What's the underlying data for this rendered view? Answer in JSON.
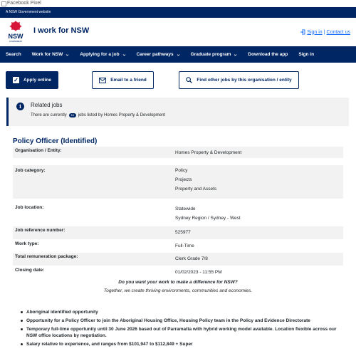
{
  "fb_pixel_alt": "Facebook Pixel",
  "gov_strip": "A NSW Government website",
  "header": {
    "site_title": "I work for NSW",
    "logo_text": "NSW",
    "logo_subtext": "GOVERNMENT",
    "sign_in": "Sign in",
    "contact_us": "Contact us",
    "separator": "|"
  },
  "nav": {
    "items": [
      {
        "label": "Search",
        "dropdown": false
      },
      {
        "label": "Work for NSW",
        "dropdown": true
      },
      {
        "label": "Applying for a job",
        "dropdown": true
      },
      {
        "label": "Career pathways",
        "dropdown": true
      },
      {
        "label": "Graduate program",
        "dropdown": true
      },
      {
        "label": "Download the app",
        "dropdown": false
      },
      {
        "label": "Sign in",
        "dropdown": false
      }
    ],
    "chevron": "⌄"
  },
  "actions": {
    "apply": "Apply online",
    "email": "Email to a friend",
    "find": "Find other jobs by this organisation / entity"
  },
  "related": {
    "title": "Related jobs",
    "text_before": "There are currently",
    "count": "16",
    "text_after": "jobs listed by Homes Property & Development"
  },
  "job": {
    "title": "Policy Officer (Identified)",
    "rows": [
      {
        "label": "Organisation / Entity:",
        "values": [
          "Homes Property & Development"
        ]
      },
      {
        "label": "Job category:",
        "values": [
          "Policy",
          "Projects",
          "Property and Assets"
        ]
      },
      {
        "label": "Job location:",
        "values": [
          "Statewide",
          "Sydney Region / Sydney - West"
        ]
      },
      {
        "label": "Job reference number:",
        "values": [
          "525977"
        ]
      },
      {
        "label": "Work type:",
        "values": [
          "Full-Time"
        ]
      },
      {
        "label": "Total remuneration package:",
        "values": [
          "Clerk Grade 7/8"
        ]
      },
      {
        "label": "Closing date:",
        "values": [
          "01/02/2023 - 11:55 PM"
        ]
      }
    ]
  },
  "tagline": {
    "question": "Do you want your work to make a difference for NSW?",
    "statement": "Together, we create thriving environments, communities and economies."
  },
  "bullets": [
    "Aboriginal identified opportunity",
    "Opportunity for a Policy Officer to join the Aboriginal Housing Office, Housing Policy team in the Policy and Evidence Directorate",
    "Temporary full-time opportunity until 30 June 2026 based out of Parramatta with hybrid working model available. Location flexible across our NSW office locations by negotiation.",
    "Salary relative to experience, and ranges from $101,947 to $112,849 + Super"
  ],
  "colors": {
    "navy": "#002664",
    "red": "#d7153a",
    "link": "#146cfd"
  }
}
